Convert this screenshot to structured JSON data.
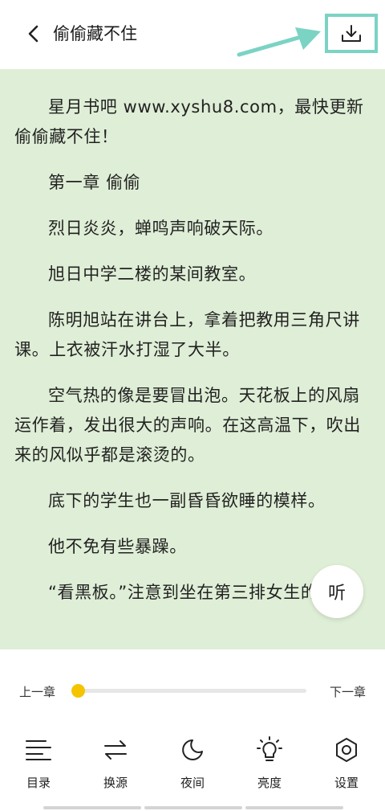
{
  "header": {
    "title": "偷偷藏不住",
    "back_icon": "chevron-left-icon",
    "download_icon": "download-icon"
  },
  "content": {
    "paragraphs": [
      "星月书吧 www.xyshu8.com，最快更新偷偷藏不住！",
      "第一章 偷偷",
      "烈日炎炎，蝉鸣声响破天际。",
      "旭日中学二楼的某间教室。",
      "陈明旭站在讲台上，拿着把教用三角尺讲课。上衣被汗水打湿了大半。",
      "空气热的像是要冒出泡。天花板上的风扇运作着，发出很大的声响。在这高温下，吹出来的风似乎都是滚烫的。",
      "底下的学生也一副昏昏欲睡的模样。",
      "他不免有些暴躁。",
      "“看黑板。”注意到坐在第三排女生的"
    ]
  },
  "listen_button": {
    "label": "听"
  },
  "chapter_nav": {
    "prev_label": "上一章",
    "next_label": "下一章",
    "progress": 0
  },
  "toolbar": {
    "items": [
      {
        "label": "目录",
        "icon": "list-icon"
      },
      {
        "label": "换源",
        "icon": "swap-icon"
      },
      {
        "label": "夜间",
        "icon": "moon-icon"
      },
      {
        "label": "亮度",
        "icon": "bulb-icon"
      },
      {
        "label": "设置",
        "icon": "gear-icon"
      }
    ]
  },
  "colors": {
    "reading_bg": "#dfeed6",
    "accent": "#f5c400",
    "annotation": "#7bd3c4"
  }
}
